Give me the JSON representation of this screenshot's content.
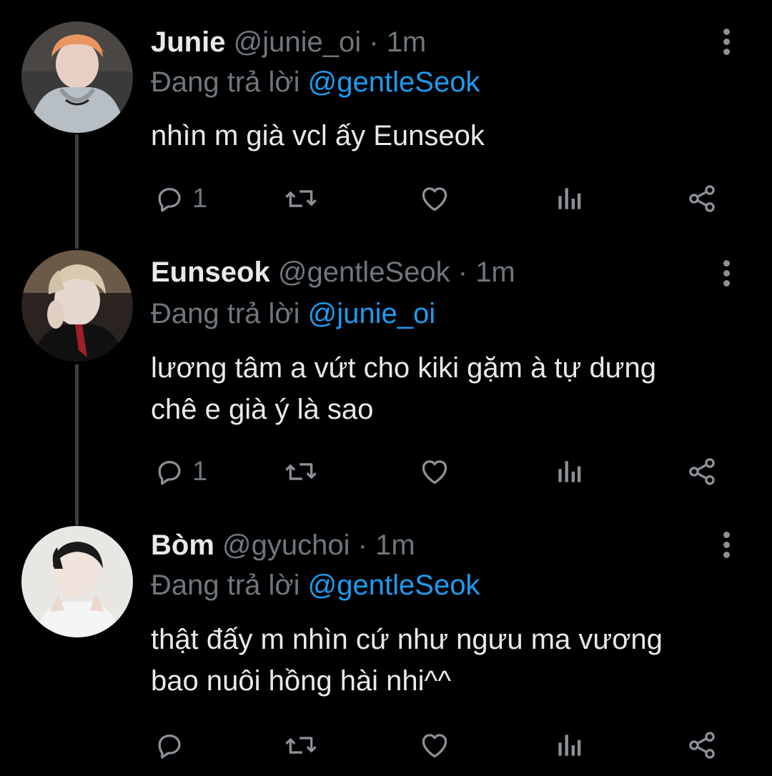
{
  "colors": {
    "background": "#000000",
    "name": "#e8e9ea",
    "muted": "#6e767d",
    "mention": "#1d9bf0",
    "icon": "#8b9198",
    "thread_line": "#3b3f44"
  },
  "tweets": [
    {
      "name": "Junie",
      "handle": "@junie_oi",
      "dot": "·",
      "time": "1m",
      "reply_prefix": "Đang trả lời",
      "reply_to": "@gentleSeok",
      "text": "nhìn m già vcl ấy Eunseok",
      "reply_count": "1",
      "icons": [
        "reply-icon",
        "retweet-icon",
        "like-icon",
        "analytics-icon",
        "share-icon",
        "more-options-icon"
      ]
    },
    {
      "name": "Eunseok",
      "handle": "@gentleSeok",
      "dot": "·",
      "time": "1m",
      "reply_prefix": "Đang trả lời",
      "reply_to": "@junie_oi",
      "text": "lương tâm a vứt cho kiki gặm à tự dưng chê e già ý là sao",
      "reply_count": "1",
      "icons": [
        "reply-icon",
        "retweet-icon",
        "like-icon",
        "analytics-icon",
        "share-icon",
        "more-options-icon"
      ]
    },
    {
      "name": "Bòm",
      "handle": "@gyuchoi",
      "dot": "·",
      "time": "1m",
      "reply_prefix": "Đang trả lời",
      "reply_to": "@gentleSeok",
      "text": "thật đấy m nhìn cứ như ngưu ma vương bao nuôi hồng hài nhi^^",
      "reply_count": "",
      "icons": [
        "reply-icon",
        "retweet-icon",
        "like-icon",
        "analytics-icon",
        "share-icon",
        "more-options-icon"
      ]
    }
  ]
}
